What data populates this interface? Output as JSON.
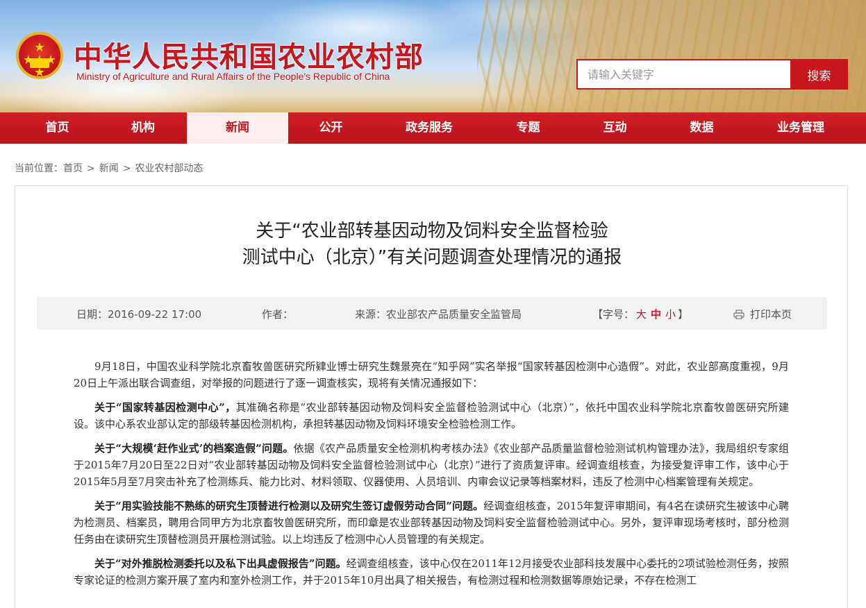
{
  "header": {
    "site_title": "中华人民共和国农业农村部",
    "site_subtitle": "Ministry of Agriculture and Rural Affairs of the People's Republic of China",
    "emblem_stars": "★ ★★★ ★"
  },
  "search": {
    "placeholder": "请输入关键字",
    "button_label": "搜索"
  },
  "nav": {
    "items": [
      {
        "label": "首页"
      },
      {
        "label": "机构"
      },
      {
        "label": "新闻"
      },
      {
        "label": "公开"
      },
      {
        "label": "政务服务"
      },
      {
        "label": "专题"
      },
      {
        "label": "互动"
      },
      {
        "label": "数据"
      },
      {
        "label": "业务管理"
      }
    ],
    "active_index": 2
  },
  "breadcrumb": {
    "prefix": "当前位置：",
    "items": [
      "首页",
      "新闻",
      "农业农村部动态"
    ],
    "separator": ">"
  },
  "article": {
    "title_line1": "关于“农业部转基因动物及饲料安全监督检验",
    "title_line2": "测试中心（北京）”有关问题调查处理情况的通报",
    "meta": {
      "date": "日期：2016-09-22 17:00",
      "author": "作者：",
      "source": "来源：农业部农产品质量安全监管局",
      "fontsize_open": "【字号：",
      "fontsize_large": "大",
      "fontsize_medium": "中",
      "fontsize_small": "小",
      "fontsize_close": "】",
      "print": "打印本页"
    },
    "paragraphs": [
      {
        "lead": "",
        "text": "9月18日，中国农业科学院北京畜牧兽医研究所肄业博士研究生魏景亮在“知乎网”实名举报“国家转基因检测中心造假”。对此，农业部高度重视，9月20日上午派出联合调查组，对举报的问题进行了逐一调查核实，现将有关情况通报如下："
      },
      {
        "lead": "关于“国家转基因检测中心”，",
        "text": "其准确名称是“农业部转基因动物及饲料安全监督检验测试中心（北京）”，依托中国农业科学院北京畜牧兽医研究所建设。该中心系农业部认定的部级转基因检测机构，承担转基因动物及饲料环境安全检验检测工作。"
      },
      {
        "lead": "关于“大规模‘赶作业式’的档案造假”问题。",
        "text": "依据《农产品质量安全检测机构考核办法》《农业部产品质量监督检验测试机构管理办法》，我局组织专家组于2015年7月20日至22日对“农业部转基因动物及饲料安全监督检验测试中心（北京）”进行了资质复评审。经调查组核查，为接受复评审工作，该中心于2015年5月至7月突击补充了检测练兵、能力比对、材料领取、仪器使用、人员培训、内审会议记录等档案材料，违反了检测中心档案管理有关规定。"
      },
      {
        "lead": "关于“用实验技能不熟练的研究生顶替进行检测以及研究生签订虚假劳动合同”问题。",
        "text": "经调查组核查，2015年复评审期间，有4名在读研究生被该中心聘为检测员、档案员，聘用合同甲方为北京畜牧兽医研究所，而印章是农业部转基因动物及饲料安全监督检验测试中心。另外，复评审现场考核时，部分检测任务由在读研究生顶替检测员开展检测试验。以上均违反了检测中心人员管理的有关规定。"
      },
      {
        "lead": "关于“对外推脱检测委托以及私下出具虚假报告”问题。",
        "text": "经调查组核查，该中心仅在2011年12月接受农业部科技发展中心委托的2项试验检测任务，按照专家论证的检测方案开展了室内和室外检测工作，并于2015年10月出具了相关报告，有检测过程和检测数据等原始记录，不存在检测工"
      }
    ]
  },
  "colors": {
    "brand_red": "#c8161d",
    "nav_active_bg": "#fbeeee",
    "meta_bar_bg": "#f2f2f2"
  }
}
